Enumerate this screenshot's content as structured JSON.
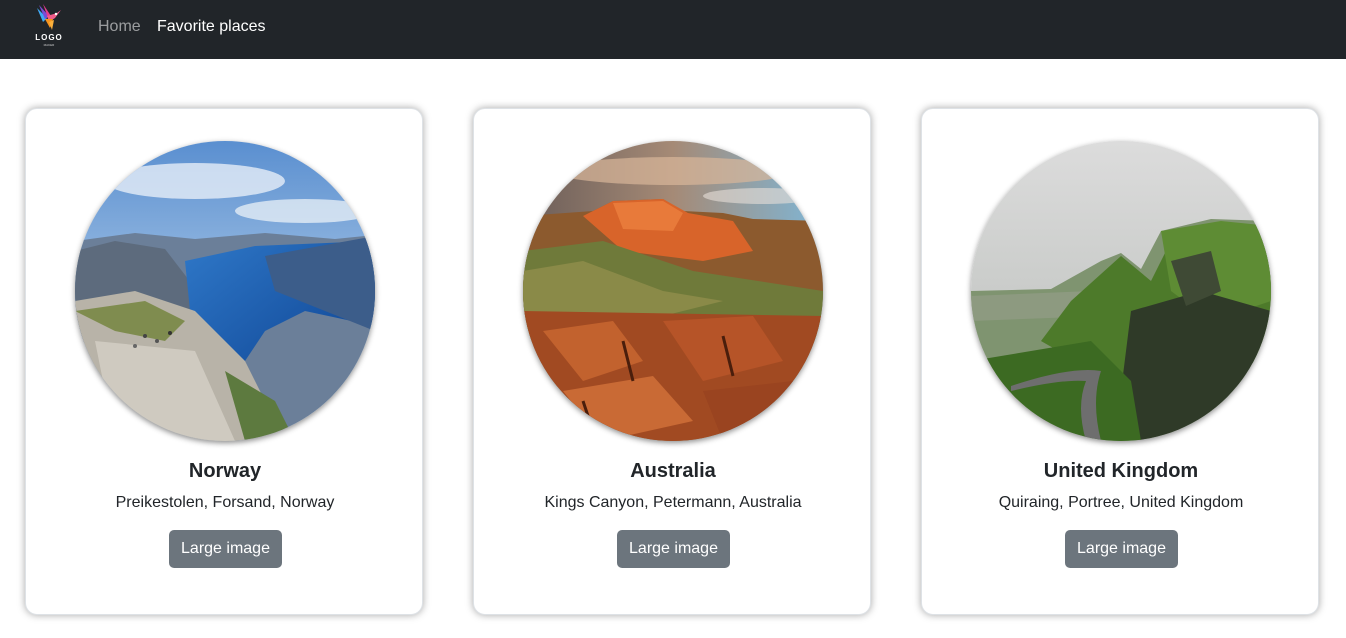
{
  "nav": {
    "logo_text": "LOGO",
    "logo_subtext": "MAKER",
    "links": [
      {
        "label": "Home",
        "active": false
      },
      {
        "label": "Favorite places",
        "active": true
      }
    ]
  },
  "places": [
    {
      "title": "Norway",
      "description": "Preikestolen, Forsand, Norway",
      "button_label": "Large image",
      "image": "fjord-cliff-photo"
    },
    {
      "title": "Australia",
      "description": "Kings Canyon, Petermann, Australia",
      "button_label": "Large image",
      "image": "red-canyon-photo"
    },
    {
      "title": "United Kingdom",
      "description": "Quiraing, Portree, United Kingdom",
      "button_label": "Large image",
      "image": "green-hills-road-photo"
    }
  ],
  "colors": {
    "navbar_bg": "#212529",
    "nav_active": "#ffffff",
    "nav_inactive": "#8c8f91",
    "button_bg": "#6c757d",
    "button_text": "#ffffff"
  }
}
